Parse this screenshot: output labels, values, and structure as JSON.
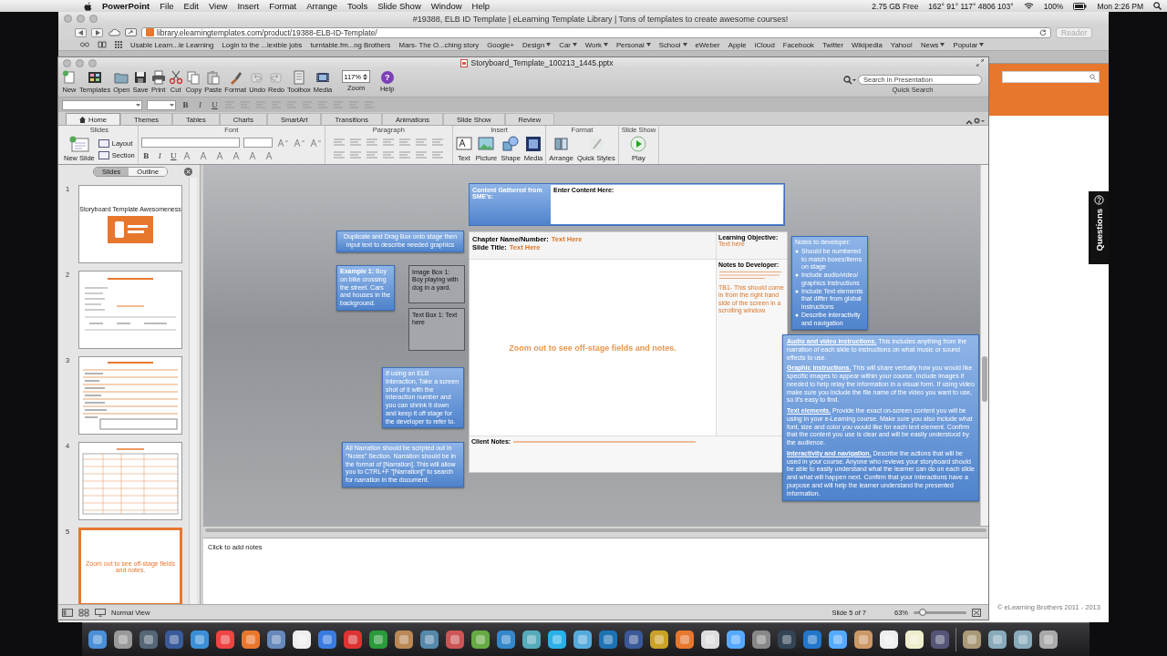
{
  "menubar": {
    "app": "PowerPoint",
    "menus": [
      "File",
      "Edit",
      "View",
      "Insert",
      "Format",
      "Arrange",
      "Tools",
      "Slide Show",
      "Window",
      "Help"
    ],
    "status": [
      "2.75 GB Free",
      "162° 91° 117° 4806 103°",
      "100%",
      "Mon 2:26 PM"
    ]
  },
  "browser": {
    "title": "#19388, ELB ID Template | eLearning Template Library | Tons of templates to create awesome courses!",
    "url": "library.elearningtemplates.com/product/19388-ELB-ID-Template/",
    "reader": "Reader",
    "bookmarks": [
      {
        "label": "Usable Learn...le Learning",
        "menu": false
      },
      {
        "label": "Login to the ...lexible jobs",
        "menu": false
      },
      {
        "label": "turntable.fm...ng Brothers",
        "menu": false
      },
      {
        "label": "Mars- The O...ching story",
        "menu": false
      },
      {
        "label": "Google+",
        "menu": false
      },
      {
        "label": "Design",
        "menu": true
      },
      {
        "label": "Car",
        "menu": true
      },
      {
        "label": "Work",
        "menu": true
      },
      {
        "label": "Personal",
        "menu": true
      },
      {
        "label": "School",
        "menu": true
      },
      {
        "label": "eWeber",
        "menu": false
      },
      {
        "label": "Apple",
        "menu": false
      },
      {
        "label": "iCloud",
        "menu": false
      },
      {
        "label": "Facebook",
        "menu": false
      },
      {
        "label": "Twitter",
        "menu": false
      },
      {
        "label": "Wikipedia",
        "menu": false
      },
      {
        "label": "Yahoo!",
        "menu": false
      },
      {
        "label": "News",
        "menu": true
      },
      {
        "label": "Popular",
        "menu": true
      }
    ],
    "page": {
      "questions_tab": "Questions",
      "copyright": "© eLearning Brothers 2011 - 2013"
    }
  },
  "ppt": {
    "title": "Storyboard_Template_100213_1445.pptx",
    "toolbar": [
      "New",
      "Templates",
      "Open",
      "Save",
      "Print",
      "Cut",
      "Copy",
      "Paste",
      "Format",
      "Undo",
      "Redo",
      "Toolbox",
      "Media"
    ],
    "zoom": {
      "value": "117%",
      "label": "Zoom"
    },
    "help": {
      "glyph": "?",
      "label": "Help"
    },
    "search": {
      "placeholder": "Search in Presentation",
      "label": "Quick Search"
    },
    "format_bar": [
      "B",
      "I",
      "U"
    ],
    "ribbon_tabs": [
      {
        "label": "Home",
        "selected": true
      },
      {
        "label": "Themes",
        "selected": false
      },
      {
        "label": "Tables",
        "selected": false
      },
      {
        "label": "Charts",
        "selected": false
      },
      {
        "label": "SmartArt",
        "selected": false
      },
      {
        "label": "Transitions",
        "selected": false
      },
      {
        "label": "Animations",
        "selected": false
      },
      {
        "label": "Slide Show",
        "selected": false
      },
      {
        "label": "Review",
        "selected": false
      }
    ],
    "ribbon_groups": [
      {
        "title": "Slides",
        "kind": "slides",
        "buttons": [
          "New Slide",
          "Layout",
          "Section"
        ]
      },
      {
        "title": "Font",
        "kind": "font",
        "buttons": [
          "B",
          "I",
          "U"
        ]
      },
      {
        "title": "Paragraph",
        "kind": "paragraph"
      },
      {
        "title": "Insert",
        "kind": "large",
        "buttons": [
          "Text",
          "Picture",
          "Shape",
          "Media"
        ]
      },
      {
        "title": "Format",
        "kind": "large",
        "buttons": [
          "Arrange",
          "Quick Styles"
        ]
      },
      {
        "title": "Slide Show",
        "kind": "large",
        "buttons": [
          "Play"
        ]
      }
    ],
    "pane_tabs": [
      {
        "label": "Slides",
        "selected": true
      },
      {
        "label": "Outline",
        "selected": false
      }
    ],
    "slides": [
      {
        "number": "1",
        "kind": "title",
        "text": "Storyboard Template Awesomeness",
        "selected": false
      },
      {
        "number": "2",
        "kind": "lines",
        "selected": false
      },
      {
        "number": "3",
        "kind": "form",
        "selected": false
      },
      {
        "number": "4",
        "kind": "table",
        "selected": false
      },
      {
        "number": "5",
        "kind": "message",
        "text": "Zoom out to see off-stage fields and notes.",
        "selected": true
      }
    ],
    "slide": {
      "sme_label": "Content Gathered from SME's:",
      "sme_field": "Enter Content Here:",
      "chapter_label": "Chapter Name/Number:",
      "chapter_value": "Text Here",
      "title_label": "Slide Title:",
      "title_value": "Text Here",
      "objective_label": "Learning Objective:",
      "objective_value": "Text here",
      "dev_label": "Notes to Developer:",
      "dev_note_2": "TB1- This should come in from the right hand side of the screen in a scrolling window.",
      "center": "Zoom out to see off-stage fields and notes.",
      "client_label": "Client Notes:"
    },
    "offstage": {
      "duplicate": "Duplicate and Drag Box onto stage then input text to describe needed graphics",
      "example_label": "Example 1:",
      "example_text": " Boy on bike crossing the street. Cars and houses in the background.",
      "image_box": "Image Box 1: Boy playing with dog in a yard.",
      "text_box": "Text Box 1: Text here",
      "interaction": "If using an ELB Interaction, Take a screen shot of it with the interaction number and you can shrink it down and keep it off stage for the developer to refer to.",
      "narration": "All Narration should be scripted out in \"Notes\" Section.  Narration should be in the format of [Narration]. This will allow you to CTRL+F \"[Narration]\" to search for narration in the document.",
      "dev_title": "Notes to developer:",
      "dev_items": [
        "Should be numbered to match boxes/items on stage",
        "Include audio/video/ graphics instructions",
        "Include Text elements that differ from global instructions",
        "Describe interactivity and navigation"
      ],
      "instructions": [
        {
          "title": "Audio and video instructions.",
          "text": " This includes anything from the narration of each slide to instructions on what music or sound effects to use."
        },
        {
          "title": "Graphic instructions.",
          "text": " This will share verbally how you would like specific images to appear within your course. Include images if needed to help relay the information in a visual form. If using video make sure you include the file name of the video you want to use, so it's easy to find."
        },
        {
          "title": "Text elements.",
          "text": " Provide the exact on-screen content you will be using in your e-Learning course. Make sure you also include what font, size and color you would like for each text element. Confirm that the content you use is clear and will be easily understood by the audience."
        },
        {
          "title": "Interactivity and navigation.",
          "text": " Describe the actions that will be used in your course. Anyone who reviews your storyboard should be able to easily understand what the learner can do on each slide and what will happen next. Confirm that your interactions have a purpose and will help the learner understand the presented information."
        }
      ]
    },
    "notes": {
      "placeholder": "Click to add notes"
    },
    "status": {
      "view": "Normal View",
      "slide": "Slide 5 of 7",
      "zoom": "63%",
      "level": 0.17
    }
  }
}
